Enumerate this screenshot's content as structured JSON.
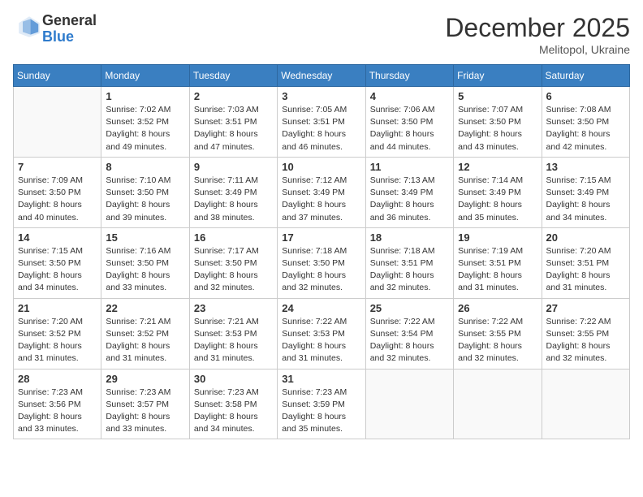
{
  "header": {
    "logo_general": "General",
    "logo_blue": "Blue",
    "month": "December 2025",
    "location": "Melitopol, Ukraine"
  },
  "days_of_week": [
    "Sunday",
    "Monday",
    "Tuesday",
    "Wednesday",
    "Thursday",
    "Friday",
    "Saturday"
  ],
  "weeks": [
    [
      {
        "day": "",
        "sunrise": "",
        "sunset": "",
        "daylight": ""
      },
      {
        "day": "1",
        "sunrise": "7:02 AM",
        "sunset": "3:52 PM",
        "daylight": "8 hours and 49 minutes."
      },
      {
        "day": "2",
        "sunrise": "7:03 AM",
        "sunset": "3:51 PM",
        "daylight": "8 hours and 47 minutes."
      },
      {
        "day": "3",
        "sunrise": "7:05 AM",
        "sunset": "3:51 PM",
        "daylight": "8 hours and 46 minutes."
      },
      {
        "day": "4",
        "sunrise": "7:06 AM",
        "sunset": "3:50 PM",
        "daylight": "8 hours and 44 minutes."
      },
      {
        "day": "5",
        "sunrise": "7:07 AM",
        "sunset": "3:50 PM",
        "daylight": "8 hours and 43 minutes."
      },
      {
        "day": "6",
        "sunrise": "7:08 AM",
        "sunset": "3:50 PM",
        "daylight": "8 hours and 42 minutes."
      }
    ],
    [
      {
        "day": "7",
        "sunrise": "7:09 AM",
        "sunset": "3:50 PM",
        "daylight": "8 hours and 40 minutes."
      },
      {
        "day": "8",
        "sunrise": "7:10 AM",
        "sunset": "3:50 PM",
        "daylight": "8 hours and 39 minutes."
      },
      {
        "day": "9",
        "sunrise": "7:11 AM",
        "sunset": "3:49 PM",
        "daylight": "8 hours and 38 minutes."
      },
      {
        "day": "10",
        "sunrise": "7:12 AM",
        "sunset": "3:49 PM",
        "daylight": "8 hours and 37 minutes."
      },
      {
        "day": "11",
        "sunrise": "7:13 AM",
        "sunset": "3:49 PM",
        "daylight": "8 hours and 36 minutes."
      },
      {
        "day": "12",
        "sunrise": "7:14 AM",
        "sunset": "3:49 PM",
        "daylight": "8 hours and 35 minutes."
      },
      {
        "day": "13",
        "sunrise": "7:15 AM",
        "sunset": "3:49 PM",
        "daylight": "8 hours and 34 minutes."
      }
    ],
    [
      {
        "day": "14",
        "sunrise": "7:15 AM",
        "sunset": "3:50 PM",
        "daylight": "8 hours and 34 minutes."
      },
      {
        "day": "15",
        "sunrise": "7:16 AM",
        "sunset": "3:50 PM",
        "daylight": "8 hours and 33 minutes."
      },
      {
        "day": "16",
        "sunrise": "7:17 AM",
        "sunset": "3:50 PM",
        "daylight": "8 hours and 32 minutes."
      },
      {
        "day": "17",
        "sunrise": "7:18 AM",
        "sunset": "3:50 PM",
        "daylight": "8 hours and 32 minutes."
      },
      {
        "day": "18",
        "sunrise": "7:18 AM",
        "sunset": "3:51 PM",
        "daylight": "8 hours and 32 minutes."
      },
      {
        "day": "19",
        "sunrise": "7:19 AM",
        "sunset": "3:51 PM",
        "daylight": "8 hours and 31 minutes."
      },
      {
        "day": "20",
        "sunrise": "7:20 AM",
        "sunset": "3:51 PM",
        "daylight": "8 hours and 31 minutes."
      }
    ],
    [
      {
        "day": "21",
        "sunrise": "7:20 AM",
        "sunset": "3:52 PM",
        "daylight": "8 hours and 31 minutes."
      },
      {
        "day": "22",
        "sunrise": "7:21 AM",
        "sunset": "3:52 PM",
        "daylight": "8 hours and 31 minutes."
      },
      {
        "day": "23",
        "sunrise": "7:21 AM",
        "sunset": "3:53 PM",
        "daylight": "8 hours and 31 minutes."
      },
      {
        "day": "24",
        "sunrise": "7:22 AM",
        "sunset": "3:53 PM",
        "daylight": "8 hours and 31 minutes."
      },
      {
        "day": "25",
        "sunrise": "7:22 AM",
        "sunset": "3:54 PM",
        "daylight": "8 hours and 32 minutes."
      },
      {
        "day": "26",
        "sunrise": "7:22 AM",
        "sunset": "3:55 PM",
        "daylight": "8 hours and 32 minutes."
      },
      {
        "day": "27",
        "sunrise": "7:22 AM",
        "sunset": "3:55 PM",
        "daylight": "8 hours and 32 minutes."
      }
    ],
    [
      {
        "day": "28",
        "sunrise": "7:23 AM",
        "sunset": "3:56 PM",
        "daylight": "8 hours and 33 minutes."
      },
      {
        "day": "29",
        "sunrise": "7:23 AM",
        "sunset": "3:57 PM",
        "daylight": "8 hours and 33 minutes."
      },
      {
        "day": "30",
        "sunrise": "7:23 AM",
        "sunset": "3:58 PM",
        "daylight": "8 hours and 34 minutes."
      },
      {
        "day": "31",
        "sunrise": "7:23 AM",
        "sunset": "3:59 PM",
        "daylight": "8 hours and 35 minutes."
      },
      {
        "day": "",
        "sunrise": "",
        "sunset": "",
        "daylight": ""
      },
      {
        "day": "",
        "sunrise": "",
        "sunset": "",
        "daylight": ""
      },
      {
        "day": "",
        "sunrise": "",
        "sunset": "",
        "daylight": ""
      }
    ]
  ]
}
